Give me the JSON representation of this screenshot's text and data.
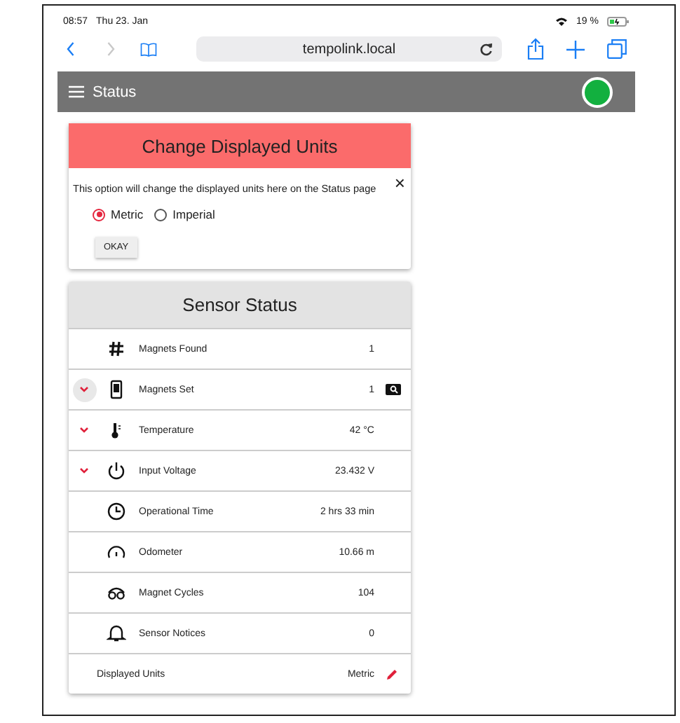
{
  "status_bar": {
    "time": "08:57",
    "date": "Thu 23. Jan",
    "battery": "19 %"
  },
  "browser": {
    "address": "tempolink.local"
  },
  "app_bar": {
    "title": "Status",
    "connected": true
  },
  "dialog": {
    "title": "Change Displayed Units",
    "message": "This option will change the displayed units here on the Status page",
    "close": "×",
    "options": [
      {
        "label": "Metric",
        "selected": true
      },
      {
        "label": "Imperial",
        "selected": false
      }
    ],
    "button": "OKAY"
  },
  "sensor_status": {
    "title": "Sensor Status",
    "rows": [
      {
        "kind": "reading",
        "label": "Magnets Found",
        "value": "1",
        "expandable": false
      },
      {
        "kind": "search",
        "label": "Magnets Set",
        "value": "1",
        "expandable": true,
        "focused": true
      },
      {
        "kind": "reading",
        "label": "Temperature",
        "value": "42 °C",
        "expandable": true
      },
      {
        "kind": "reading",
        "label": "Input Voltage",
        "value": "23.432 V",
        "expandable": true
      },
      {
        "kind": "reading",
        "label": "Operational Time",
        "value": "2 hrs 33 min",
        "expandable": false
      },
      {
        "kind": "reading",
        "label": "Odometer",
        "value": "10.66 m",
        "expandable": false
      },
      {
        "kind": "reading",
        "label": "Magnet Cycles",
        "value": "104",
        "expandable": false
      },
      {
        "kind": "reading",
        "label": "Sensor Notices",
        "value": "0",
        "expandable": false
      },
      {
        "kind": "setting",
        "label": "Displayed Units",
        "value": "Metric",
        "expandable": false
      }
    ]
  }
}
